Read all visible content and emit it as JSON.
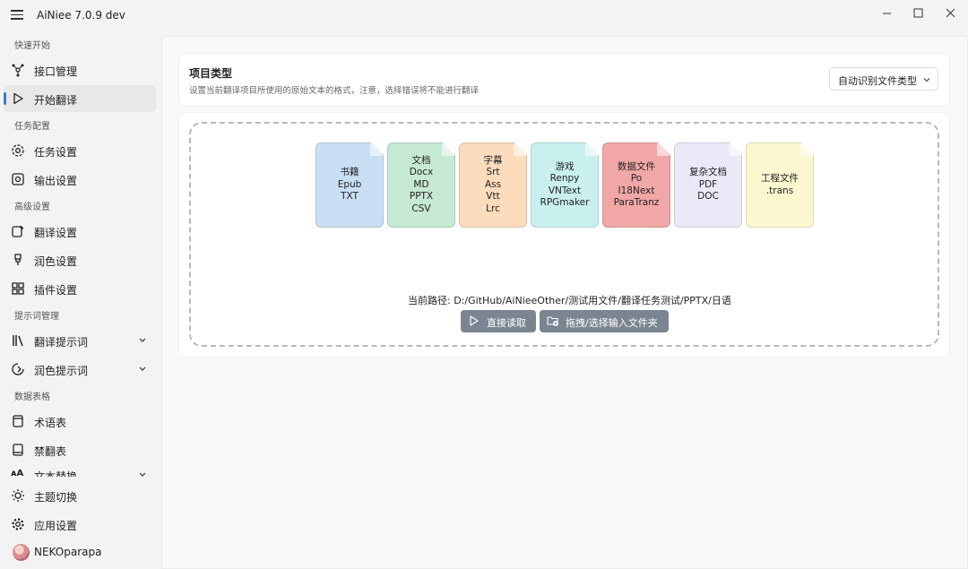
{
  "app": {
    "title": "AiNiee 7.0.9 dev"
  },
  "window_controls": {
    "minimize": "—",
    "maximize": "☐",
    "close": "✕"
  },
  "sidebar": {
    "sections": [
      "快速开始",
      "任务配置",
      "高级设置",
      "提示词管理",
      "数据表格"
    ],
    "items": [
      {
        "label": "接口管理",
        "icon": "api-icon"
      },
      {
        "label": "开始翻译",
        "icon": "play-icon",
        "active": true
      },
      {
        "label": "任务设置",
        "icon": "task-settings-icon"
      },
      {
        "label": "输出设置",
        "icon": "output-icon"
      },
      {
        "label": "翻译设置",
        "icon": "translate-settings-icon"
      },
      {
        "label": "润色设置",
        "icon": "polish-icon"
      },
      {
        "label": "插件设置",
        "icon": "plugin-icon"
      },
      {
        "label": "翻译提示词",
        "icon": "library-icon",
        "expandable": true
      },
      {
        "label": "润色提示词",
        "icon": "polish-prompt-icon",
        "expandable": true
      },
      {
        "label": "术语表",
        "icon": "glossary-icon"
      },
      {
        "label": "禁翻表",
        "icon": "exclusion-icon"
      },
      {
        "label": "文本替换",
        "icon": "text-replace-icon",
        "expandable": true
      }
    ],
    "bottom": [
      {
        "label": "主题切换",
        "icon": "theme-icon"
      },
      {
        "label": "应用设置",
        "icon": "gear-icon"
      },
      {
        "label": "NEKOparapa",
        "icon": "avatar"
      }
    ]
  },
  "project_type": {
    "title": "项目类型",
    "description": "设置当前翻译项目所使用的原始文本的格式，注意，选择错误将不能进行翻译",
    "select_value": "自动识别文件类型"
  },
  "file_types": [
    {
      "lines": [
        "书籍",
        "Epub",
        "TXT"
      ],
      "color": "#c9dff3"
    },
    {
      "lines": [
        "文档",
        "Docx",
        "MD",
        "PPTX",
        "CSV"
      ],
      "color": "#c6e9d4"
    },
    {
      "lines": [
        "字幕",
        "Srt",
        "Ass",
        "Vtt",
        "Lrc"
      ],
      "color": "#fbdcbc"
    },
    {
      "lines": [
        "游戏",
        "Renpy",
        "VNText",
        "RPGmaker"
      ],
      "color": "#c9f0ef"
    },
    {
      "lines": [
        "数据文件",
        "Po",
        "I18Next",
        "ParaTranz"
      ],
      "color": "#f2a7a7"
    },
    {
      "lines": [
        "复杂文档",
        "PDF",
        "DOC"
      ],
      "color": "#ebe8f8"
    },
    {
      "lines": [
        "工程文件",
        ".trans"
      ],
      "color": "#fbf8cf"
    }
  ],
  "current_path": "当前路径: D:/GitHub/AiNieeOther/测试用文件/翻译任务测试/PPTX/日语",
  "buttons": {
    "direct_read": "直接读取",
    "select_folder": "拖拽/选择输入文件夹"
  }
}
